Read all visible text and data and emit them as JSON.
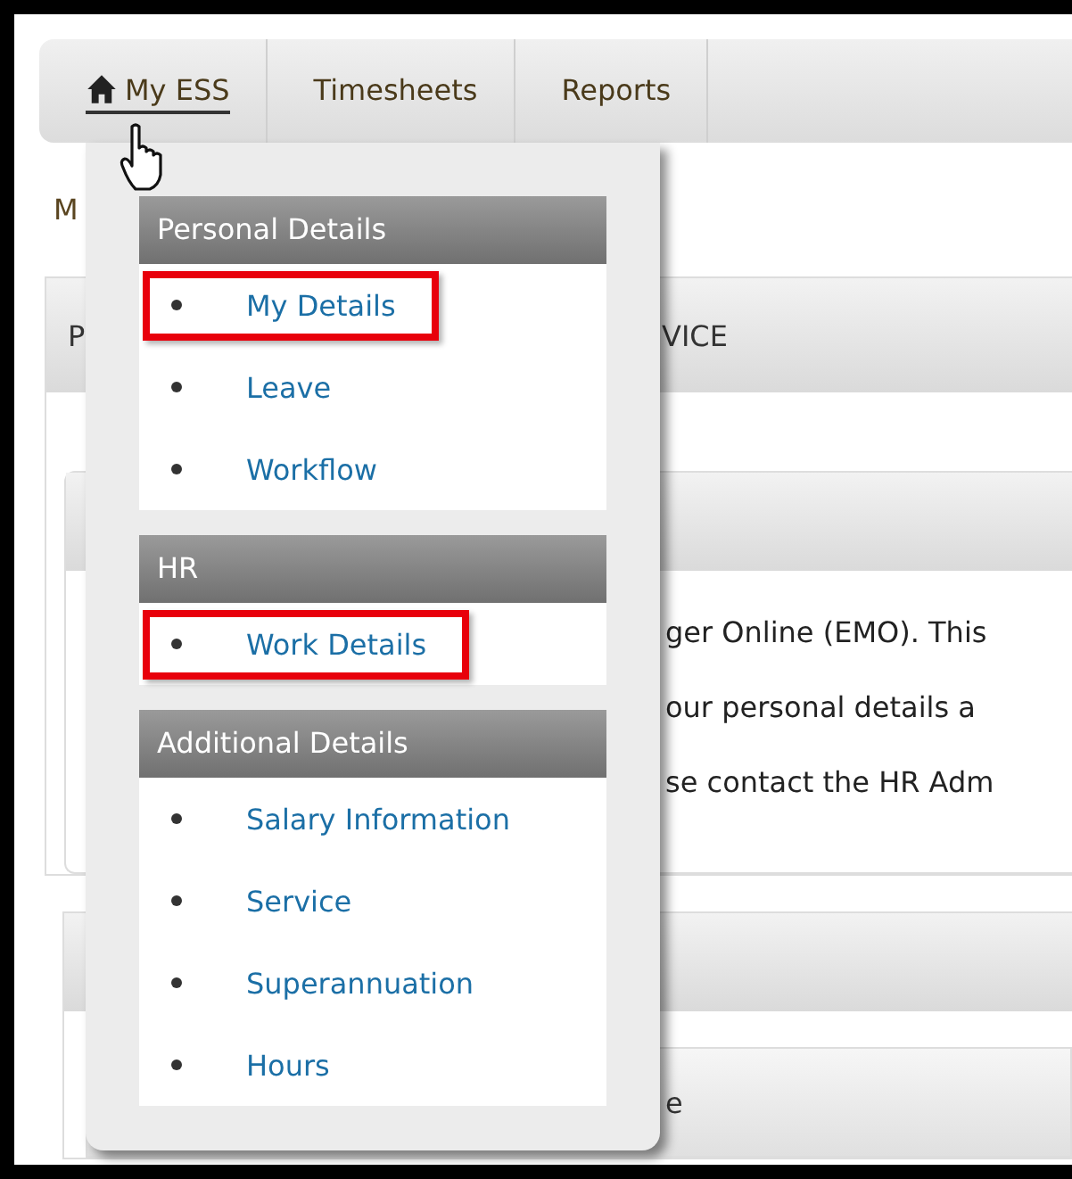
{
  "nav": {
    "items": [
      {
        "label": "My ESS",
        "selected": true
      },
      {
        "label": "Timesheets",
        "selected": false
      },
      {
        "label": "Reports",
        "selected": false
      }
    ]
  },
  "page": {
    "breadcrumb": "M",
    "panel_1": {
      "header_left": "P",
      "header_right": "VICE",
      "lines": [
        "ger Online (EMO). This",
        "our personal details a",
        "se contact the HR Adm"
      ]
    },
    "panel_2": {
      "row_text": "e"
    }
  },
  "menu": {
    "sections": [
      {
        "title": "Personal Details",
        "items": [
          {
            "label": "My Details",
            "highlighted": true
          },
          {
            "label": "Leave",
            "highlighted": false
          },
          {
            "label": "Workflow",
            "highlighted": false
          }
        ]
      },
      {
        "title": "HR",
        "items": [
          {
            "label": "Work Details",
            "highlighted": true
          }
        ]
      },
      {
        "title": "Additional Details",
        "items": [
          {
            "label": "Salary Information",
            "highlighted": false
          },
          {
            "label": "Service",
            "highlighted": false
          },
          {
            "label": "Superannuation",
            "highlighted": false
          },
          {
            "label": "Hours",
            "highlighted": false
          }
        ]
      }
    ]
  }
}
